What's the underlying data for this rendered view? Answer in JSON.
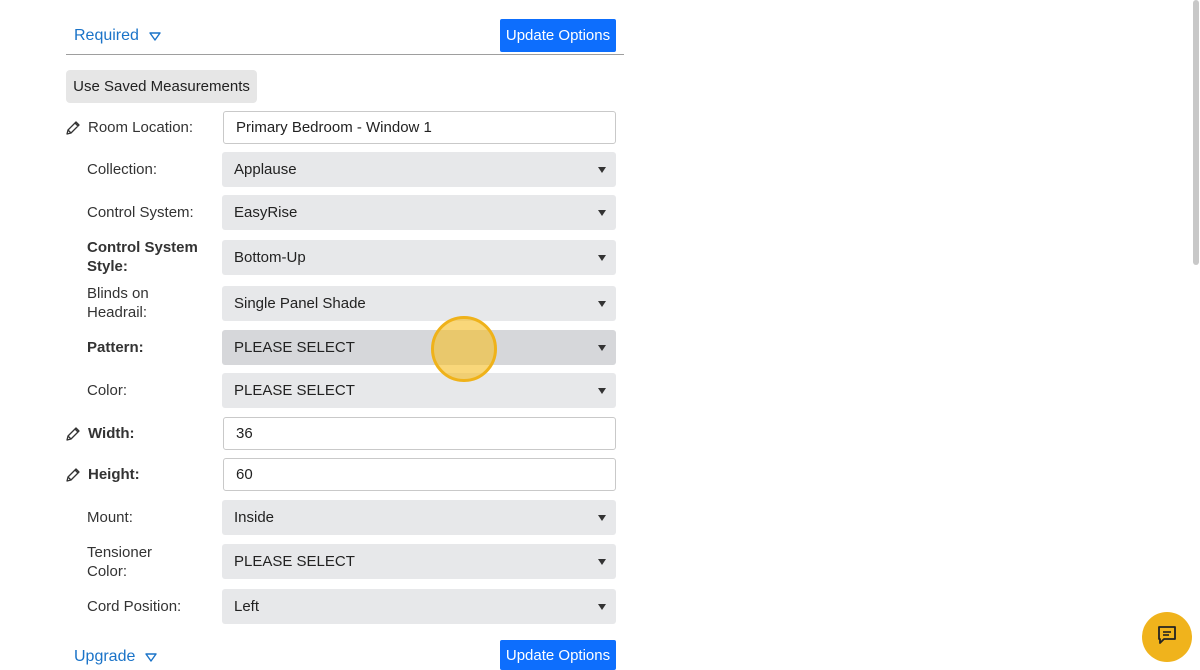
{
  "required_section": {
    "label": "Required",
    "update_label": "Update Options"
  },
  "use_saved_label": "Use Saved Measurements",
  "fields": {
    "room_location": {
      "label": "Room Location:",
      "value": "Primary Bedroom - Window 1"
    },
    "collection": {
      "label": "Collection:",
      "value": "Applause"
    },
    "control_system": {
      "label": "Control System:",
      "value": "EasyRise"
    },
    "control_system_style": {
      "label": "Control System Style:",
      "value": "Bottom-Up"
    },
    "blinds_on_headrail": {
      "label": "Blinds on Headrail:",
      "value": "Single Panel Shade"
    },
    "pattern": {
      "label": "Pattern:",
      "value": "PLEASE SELECT"
    },
    "color": {
      "label": "Color:",
      "value": "PLEASE SELECT"
    },
    "width": {
      "label": "Width:",
      "value": "36"
    },
    "height": {
      "label": "Height:",
      "value": "60"
    },
    "mount": {
      "label": "Mount:",
      "value": "Inside"
    },
    "tensioner_color": {
      "label": "Tensioner Color:",
      "value": "PLEASE SELECT"
    },
    "cord_position": {
      "label": "Cord Position:",
      "value": "Left"
    }
  },
  "upgrade_section": {
    "label": "Upgrade",
    "update_label": "Update Options"
  },
  "icons": {
    "edit": "pencil-icon",
    "section_toggle": "caret-down-outline-icon",
    "select": "triangle-down-icon",
    "chat": "chat-icon"
  },
  "colors": {
    "accent": "#0d6efd",
    "link": "#1a73c8",
    "highlight": "#f0b31c"
  }
}
